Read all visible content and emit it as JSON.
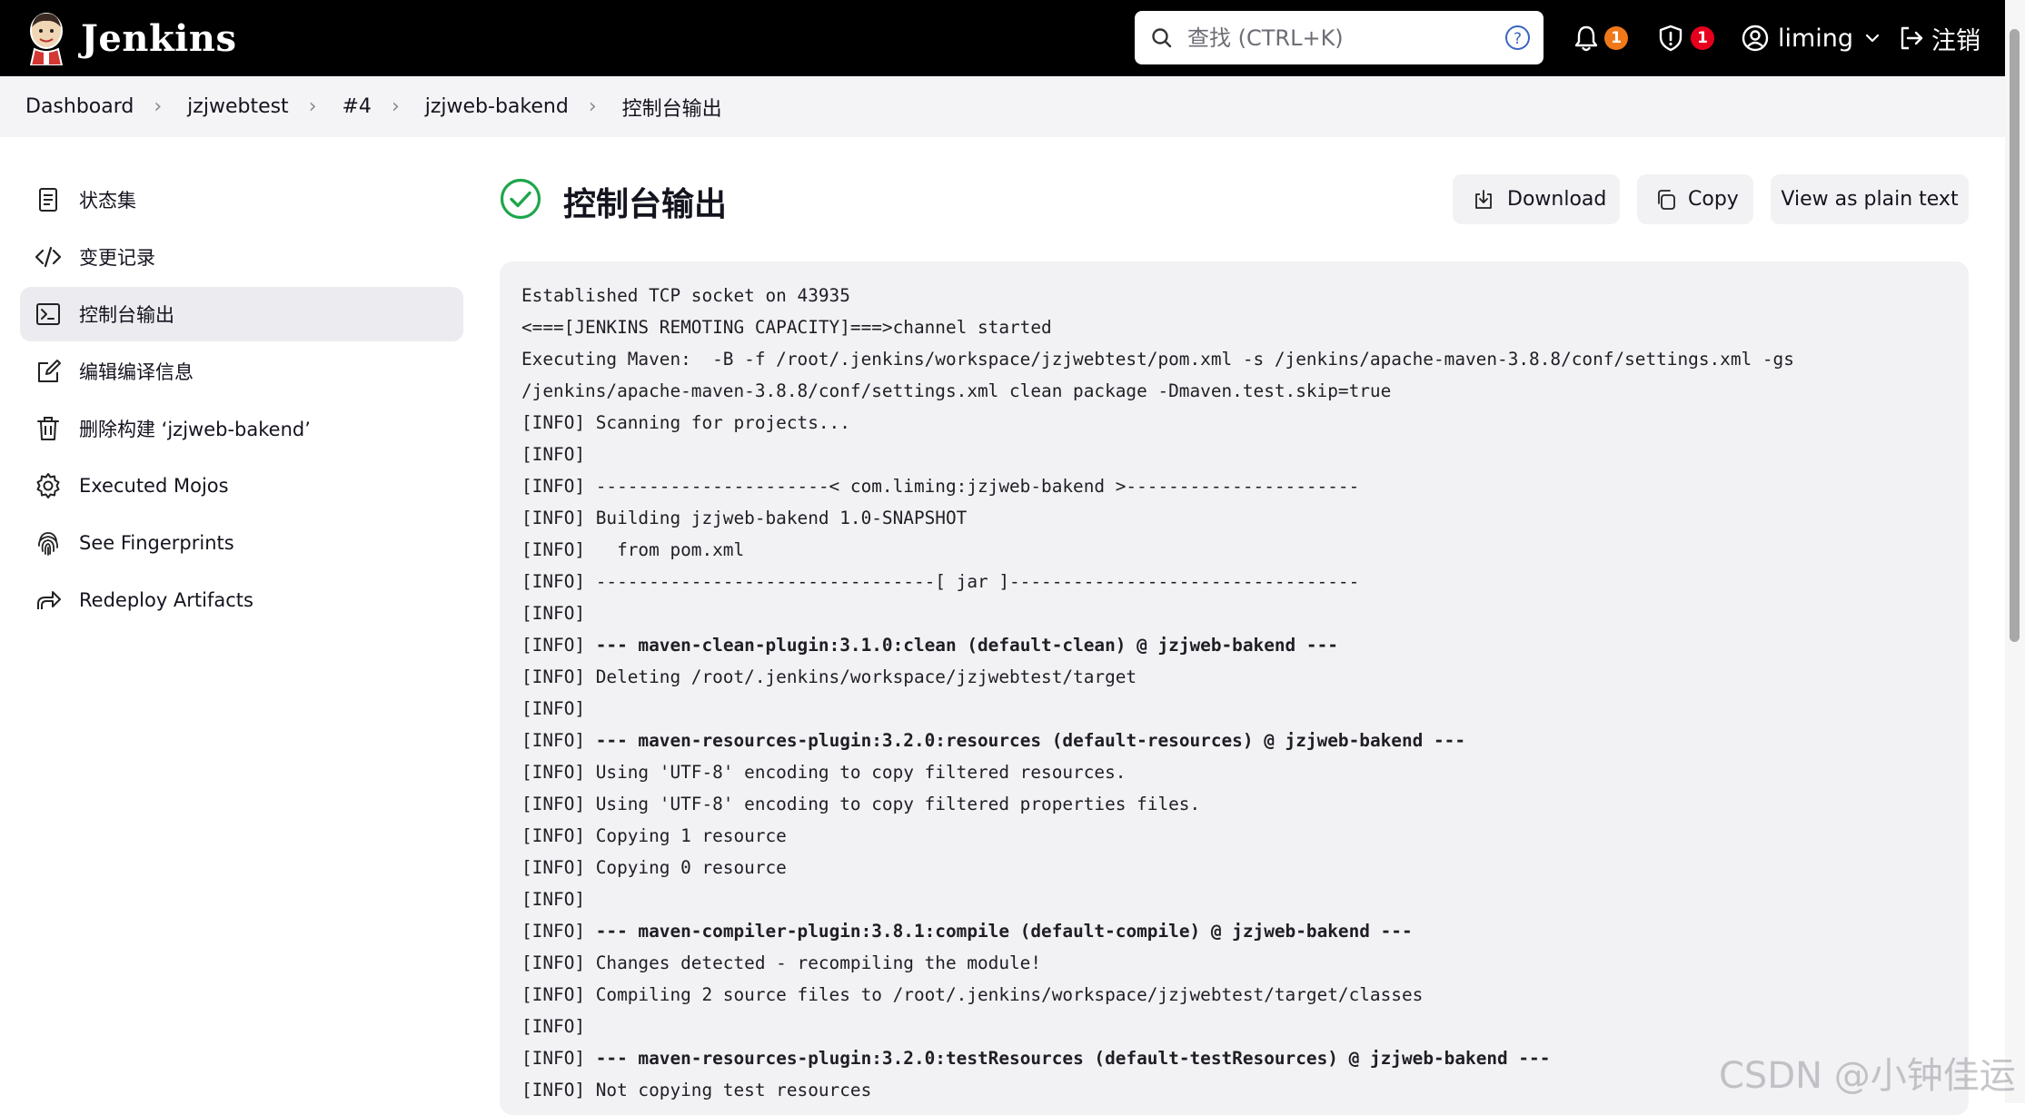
{
  "header": {
    "logo_text": "Jenkins",
    "search_placeholder": "查找 (CTRL+K)",
    "notifications_count": "1",
    "security_count": "1",
    "user": "liming",
    "logout": "注销",
    "colors": {
      "header_bg": "#000000",
      "notif_badge": "#f07818",
      "security_badge": "#e6001e"
    }
  },
  "breadcrumb": [
    "Dashboard",
    "jzjwebtest",
    "#4",
    "jzjweb-bakend",
    "控制台输出"
  ],
  "sidebar": {
    "items": [
      {
        "label": "状态集",
        "icon": "document-icon"
      },
      {
        "label": "变更记录",
        "icon": "code-icon"
      },
      {
        "label": "控制台输出",
        "icon": "terminal-icon"
      },
      {
        "label": "编辑编译信息",
        "icon": "edit-icon"
      },
      {
        "label": "删除构建 ‘jzjweb-bakend’",
        "icon": "trash-icon"
      },
      {
        "label": "Executed Mojos",
        "icon": "gear-icon"
      },
      {
        "label": "See Fingerprints",
        "icon": "fingerprint-icon"
      },
      {
        "label": "Redeploy Artifacts",
        "icon": "redeploy-icon"
      }
    ],
    "active_index": 2
  },
  "main": {
    "title": "控制台输出",
    "status_color": "#1ea64b",
    "buttons": {
      "download": "Download",
      "copy": "Copy",
      "plain": "View as plain text"
    }
  },
  "console": {
    "lines": [
      {
        "pre": "Established TCP socket on 43935",
        "bold": "",
        "post": ""
      },
      {
        "pre": "<===[JENKINS REMOTING CAPACITY]===>channel started",
        "bold": "",
        "post": ""
      },
      {
        "pre": "Executing Maven:  -B -f /root/.jenkins/workspace/jzjwebtest/pom.xml -s /jenkins/apache-maven-3.8.8/conf/settings.xml -gs",
        "bold": "",
        "post": ""
      },
      {
        "pre": "/jenkins/apache-maven-3.8.8/conf/settings.xml clean package -Dmaven.test.skip=true",
        "bold": "",
        "post": ""
      },
      {
        "pre": "[INFO] Scanning for projects...",
        "bold": "",
        "post": ""
      },
      {
        "pre": "[INFO]",
        "bold": "",
        "post": ""
      },
      {
        "pre": "[INFO] ----------------------< com.liming:jzjweb-bakend >----------------------",
        "bold": "",
        "post": ""
      },
      {
        "pre": "[INFO] Building jzjweb-bakend 1.0-SNAPSHOT",
        "bold": "",
        "post": ""
      },
      {
        "pre": "[INFO]   from pom.xml",
        "bold": "",
        "post": ""
      },
      {
        "pre": "[INFO] --------------------------------[ jar ]---------------------------------",
        "bold": "",
        "post": ""
      },
      {
        "pre": "[INFO]",
        "bold": "",
        "post": ""
      },
      {
        "pre": "[INFO] ",
        "bold": "--- maven-clean-plugin:3.1.0:clean (default-clean) @ jzjweb-bakend ---",
        "post": ""
      },
      {
        "pre": "[INFO] Deleting /root/.jenkins/workspace/jzjwebtest/target",
        "bold": "",
        "post": ""
      },
      {
        "pre": "[INFO]",
        "bold": "",
        "post": ""
      },
      {
        "pre": "[INFO] ",
        "bold": "--- maven-resources-plugin:3.2.0:resources (default-resources) @ jzjweb-bakend ---",
        "post": ""
      },
      {
        "pre": "[INFO] Using 'UTF-8' encoding to copy filtered resources.",
        "bold": "",
        "post": ""
      },
      {
        "pre": "[INFO] Using 'UTF-8' encoding to copy filtered properties files.",
        "bold": "",
        "post": ""
      },
      {
        "pre": "[INFO] Copying 1 resource",
        "bold": "",
        "post": ""
      },
      {
        "pre": "[INFO] Copying 0 resource",
        "bold": "",
        "post": ""
      },
      {
        "pre": "[INFO]",
        "bold": "",
        "post": ""
      },
      {
        "pre": "[INFO] ",
        "bold": "--- maven-compiler-plugin:3.8.1:compile (default-compile) @ jzjweb-bakend ---",
        "post": ""
      },
      {
        "pre": "[INFO] Changes detected - recompiling the module!",
        "bold": "",
        "post": ""
      },
      {
        "pre": "[INFO] Compiling 2 source files to /root/.jenkins/workspace/jzjwebtest/target/classes",
        "bold": "",
        "post": ""
      },
      {
        "pre": "[INFO]",
        "bold": "",
        "post": ""
      },
      {
        "pre": "[INFO] ",
        "bold": "--- maven-resources-plugin:3.2.0:testResources (default-testResources) @ jzjweb-bakend ---",
        "post": ""
      },
      {
        "pre": "[INFO] Not copying test resources",
        "bold": "",
        "post": ""
      }
    ]
  },
  "watermark": "CSDN @小钟佳运"
}
